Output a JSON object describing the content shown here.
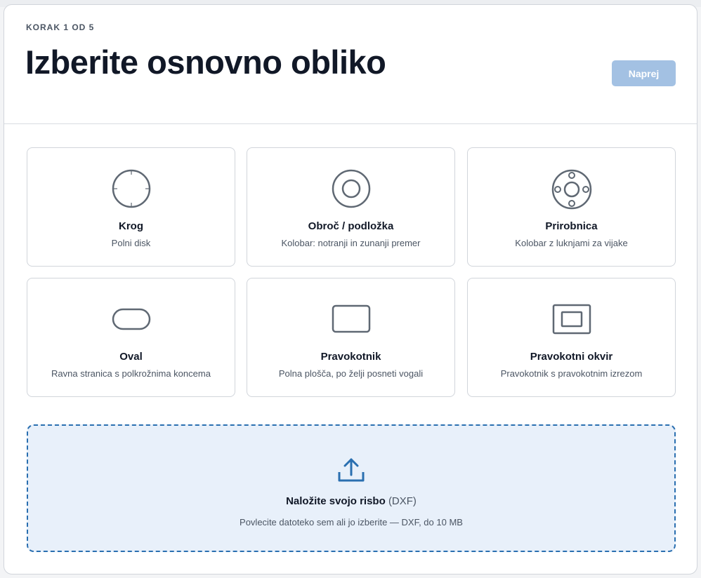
{
  "header": {
    "step": "KORAK 1 OD 5",
    "title": "Izberite osnovno obliko",
    "next_label": "Naprej"
  },
  "shapes": [
    {
      "title": "Krog",
      "subtitle": "Polni disk",
      "icon": "circle-icon"
    },
    {
      "title": "Obroč / podložka",
      "subtitle": "Kolobar: notranji in zunanji premer",
      "icon": "ring-icon"
    },
    {
      "title": "Prirobnica",
      "subtitle": "Kolobar z luknjami za vijake",
      "icon": "flange-icon"
    },
    {
      "title": "Oval",
      "subtitle": "Ravna stranica s polkrožnima koncema",
      "icon": "oval-icon"
    },
    {
      "title": "Pravokotnik",
      "subtitle": "Polna plošča, po želji posneti vogali",
      "icon": "rectangle-icon"
    },
    {
      "title": "Pravokotni okvir",
      "subtitle": "Pravokotnik s pravokotnim izrezom",
      "icon": "rectangle-frame-icon"
    }
  ],
  "upload": {
    "title": "Naložite svojo risbo",
    "format": "(DXF)",
    "hint": "Povlecite datoteko sem ali jo izberite — DXF, do 10 MB",
    "icon": "upload-icon"
  },
  "colors": {
    "accent": "#2a6fb0",
    "button_disabled": "#a3c1e3",
    "icon_stroke": "#5f6873",
    "upload_bg": "#e8f0fa"
  }
}
